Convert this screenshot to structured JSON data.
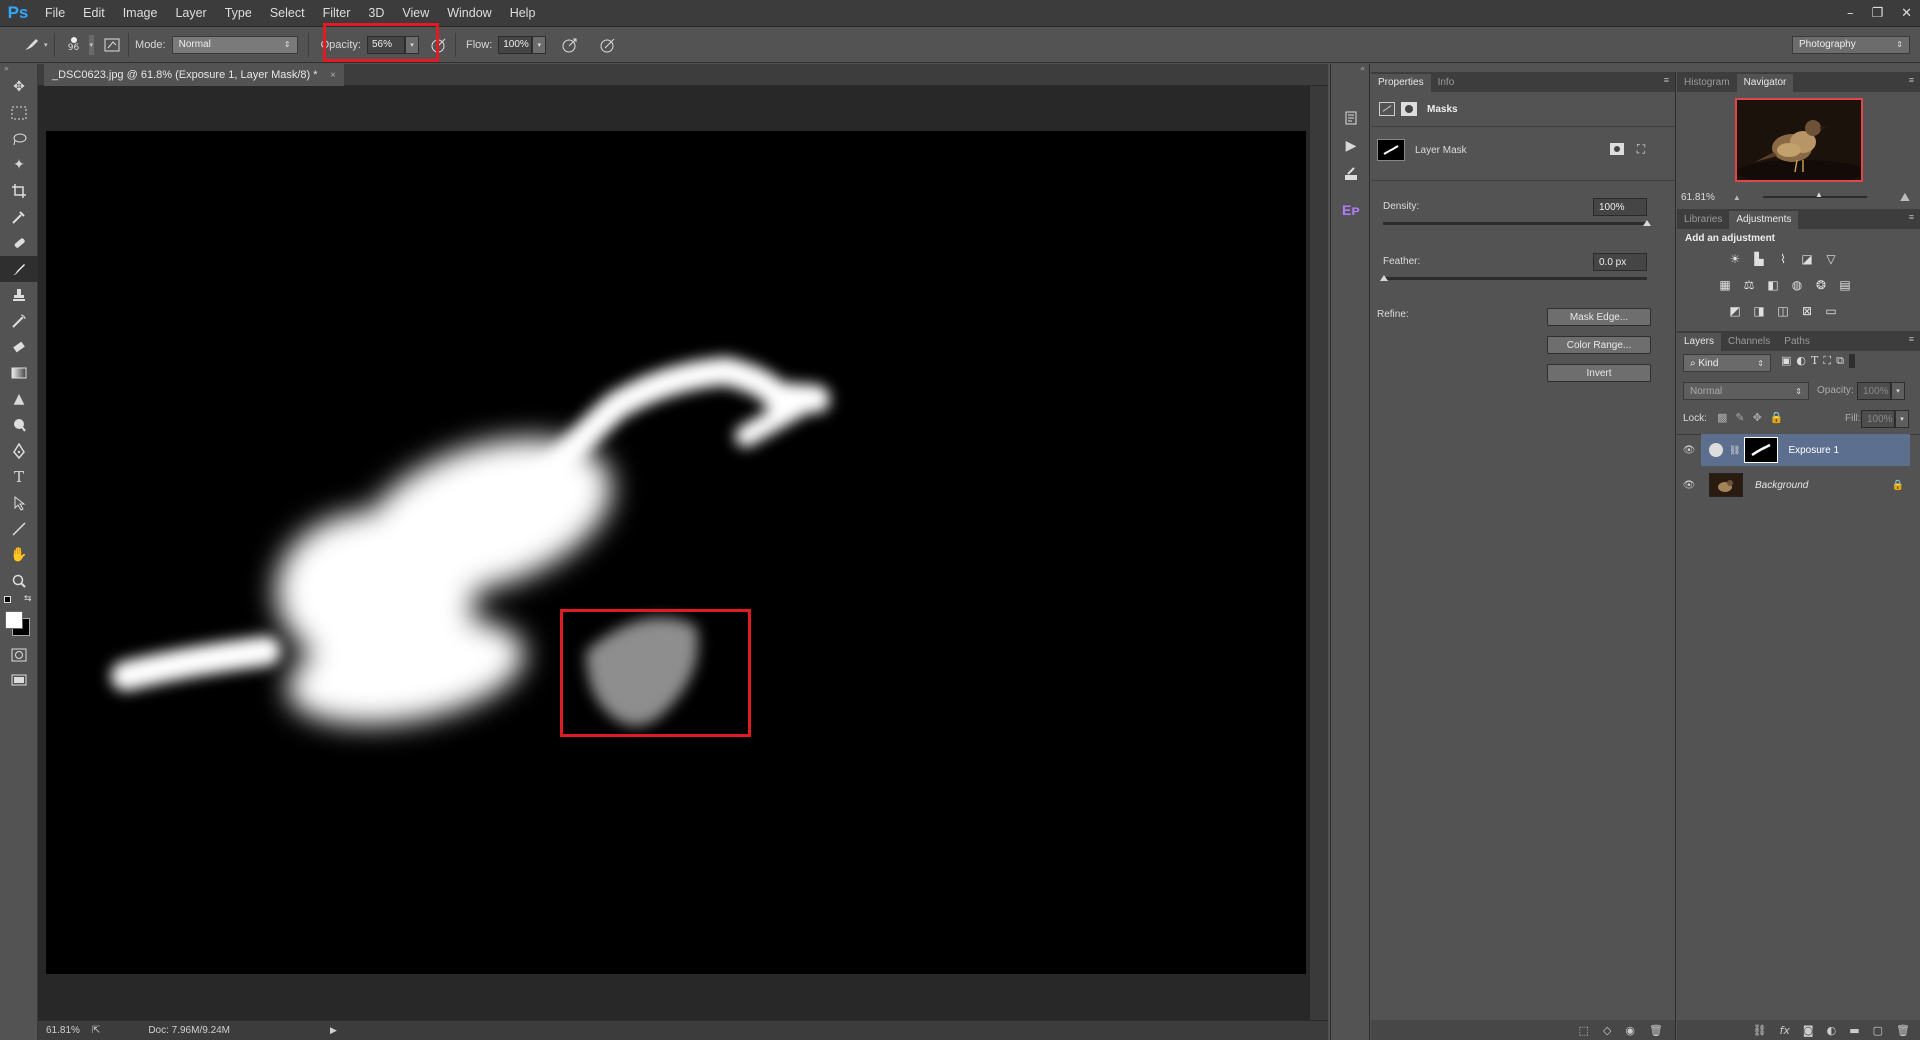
{
  "app": {
    "logo": "Ps"
  },
  "menu": [
    "File",
    "Edit",
    "Image",
    "Layer",
    "Type",
    "Select",
    "Filter",
    "3D",
    "View",
    "Window",
    "Help"
  ],
  "window_controls": {
    "minimize": "–",
    "restore": "❐",
    "close": "✕"
  },
  "options_bar": {
    "brush_size": "96",
    "mode_label": "Mode:",
    "mode_value": "Normal",
    "opacity_label": "Opacity:",
    "opacity_value": "56%",
    "flow_label": "Flow:",
    "flow_value": "100%",
    "workspace": "Photography"
  },
  "document": {
    "tab_title": "_DSC0623.jpg @ 61.8% (Exposure 1, Layer Mask/8) *",
    "close": "×"
  },
  "status": {
    "zoom": "61.81%",
    "doc": "Doc: 7.96M/9.24M"
  },
  "properties": {
    "tabs": [
      "Properties",
      "Info"
    ],
    "section": "Masks",
    "mask_name": "Layer Mask",
    "density_label": "Density:",
    "density_value": "100%",
    "feather_label": "Feather:",
    "feather_value": "0.0 px",
    "refine_label": "Refine:",
    "buttons": [
      "Mask Edge...",
      "Color Range...",
      "Invert"
    ]
  },
  "navigator": {
    "tabs": [
      "Histogram",
      "Navigator"
    ],
    "zoom": "61.81%"
  },
  "adjustments": {
    "tabs": [
      "Libraries",
      "Adjustments"
    ],
    "heading": "Add an adjustment"
  },
  "layers": {
    "tabs": [
      "Layers",
      "Channels",
      "Paths"
    ],
    "filter_kind": "Kind",
    "blend_mode": "Normal",
    "opacity_label": "Opacity:",
    "opacity_value": "100%",
    "lock_label": "Lock:",
    "fill_label": "Fill:",
    "fill_value": "100%",
    "items": [
      {
        "name": "Exposure 1"
      },
      {
        "name": "Background"
      }
    ]
  },
  "colors": {
    "highlight_box": "#e01b24",
    "selected_layer": "#5c6f8f"
  }
}
